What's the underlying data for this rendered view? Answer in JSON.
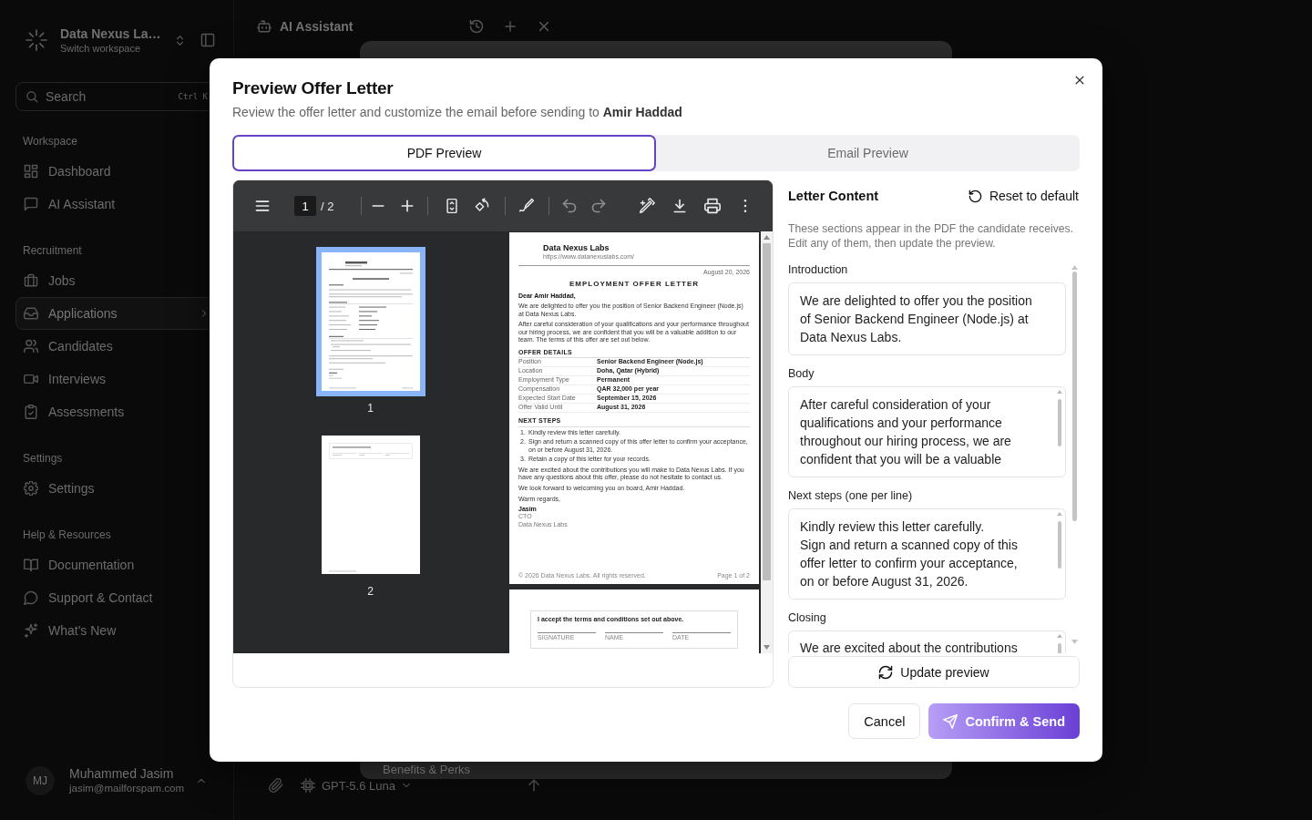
{
  "sidebar": {
    "workspace": {
      "name": "Data Nexus La…",
      "hint": "Switch workspace"
    },
    "search": {
      "placeholder": "Search",
      "shortcut": "Ctrl K"
    },
    "sections": [
      {
        "title": "Workspace",
        "items": [
          {
            "label": "Dashboard",
            "selected": false
          },
          {
            "label": "AI Assistant",
            "selected": false
          }
        ]
      },
      {
        "title": "Recruitment",
        "items": [
          {
            "label": "Jobs",
            "selected": false
          },
          {
            "label": "Applications",
            "selected": true
          },
          {
            "label": "Candidates",
            "selected": false
          },
          {
            "label": "Interviews",
            "selected": false
          },
          {
            "label": "Assessments",
            "selected": false
          }
        ]
      },
      {
        "title": "Settings",
        "items": [
          {
            "label": "Settings",
            "selected": false
          }
        ]
      },
      {
        "title": "Help & Resources",
        "items": [
          {
            "label": "Documentation",
            "selected": false
          },
          {
            "label": "Support & Contact",
            "selected": false
          },
          {
            "label": "What's New",
            "selected": false
          }
        ]
      }
    ],
    "user": {
      "initials": "MJ",
      "name": "Muhammed Jasim",
      "email": "jasim@mailforspam.com"
    }
  },
  "header": {
    "title": "AI Assistant"
  },
  "composer": {
    "message": "Benefits & Perks",
    "model": "GPT-5.6 Luna"
  },
  "modal": {
    "title": "Preview Offer Letter",
    "subtitle": "Review the offer letter and customize the email before sending to **Amir Haddad**",
    "tabs": [
      {
        "label": "PDF Preview",
        "selected": true
      },
      {
        "label": "Email Preview",
        "selected": false
      }
    ],
    "viewer": {
      "page_input": "1",
      "page_total": "/ 2",
      "undo": {
        "disabled": true
      },
      "redo": {
        "disabled": true
      },
      "thumbnails": [
        {
          "label": "1",
          "selected": true
        },
        {
          "label": "2",
          "selected": false
        }
      ],
      "letter": {
        "company": "Data Nexus Labs",
        "url": "https://www.datanexuslabs.com/",
        "date": "August 20, 2026",
        "heading": "EMPLOYMENT OFFER LETTER",
        "greeting": "Dear Amir Haddad,",
        "intro": [
          "We are delighted to offer you the position of Senior Backend Engineer (Node.js) at Data Nexus Labs.",
          "After careful consideration of your qualifications and your performance throughout our hiring process, we are confident that you will be a valuable addition to our team. The terms of this offer are set out below."
        ],
        "details_title": "OFFER DETAILS",
        "details": [
          {
            "label": "Position",
            "value": "Senior Backend Engineer (Node.js)"
          },
          {
            "label": "Location",
            "value": "Doha, Qatar (Hybrid)"
          },
          {
            "label": "Employment Type",
            "value": "Permanent"
          },
          {
            "label": "Compensation",
            "value": "QAR 32,000 per year"
          },
          {
            "label": "Expected Start Date",
            "value": "September 15, 2026"
          },
          {
            "label": "Offer Valid Until",
            "value": "August 31, 2026"
          }
        ],
        "steps_title": "NEXT STEPS",
        "steps": [
          {
            "number": "1.",
            "text": "Kindly review this letter carefully."
          },
          {
            "number": "2.",
            "text": "Sign and return a scanned copy of this offer letter to confirm your acceptance, on or before August 31, 2026."
          },
          {
            "number": "3.",
            "text": "Retain a copy of this letter for your records."
          }
        ],
        "closing": [
          "We are excited about the contributions you will make to Data Nexus Labs. If you have any questions about this offer, please do not hesitate to contact us.",
          "We look forward to welcoming you on board, Amir Haddad."
        ],
        "sign_off": "Warm regards,",
        "signer": "Jasim",
        "signer_title": "CTO",
        "signer_company": "Data Nexus Labs",
        "footer": "© 2026 Data Nexus Labs. All rights reserved.",
        "page_label": "Page 1 of 2"
      },
      "acceptance": {
        "text": "I accept the terms and conditions set out above.",
        "lines": [
          "SIGNATURE",
          "NAME",
          "DATE"
        ]
      }
    },
    "panel": {
      "title": "Letter Content",
      "reset": "Reset to default",
      "description": "These sections appear in the PDF the candidate receives. Edit any of them, then update the preview.",
      "fields": [
        {
          "label": "Introduction",
          "value": "We are delighted to offer you the position of Senior Backend Engineer (Node.js) at Data Nexus Labs.",
          "scrolls": false
        },
        {
          "label": "Body",
          "value": "After careful consideration of your qualifications and your performance throughout our hiring process, we are confident that you will be a valuable",
          "scrolls": true
        },
        {
          "label": "Next steps (one per line)",
          "value": "Kindly review this letter carefully.\nSign and return a scanned copy of this offer letter to confirm your acceptance, on or before August 31, 2026.",
          "scrolls": true
        },
        {
          "label": "Closing",
          "value": "We are excited about the contributions",
          "scrolls": true
        }
      ],
      "update": "Update preview"
    },
    "buttons": {
      "cancel": "Cancel",
      "confirm": "Confirm & Send"
    }
  }
}
